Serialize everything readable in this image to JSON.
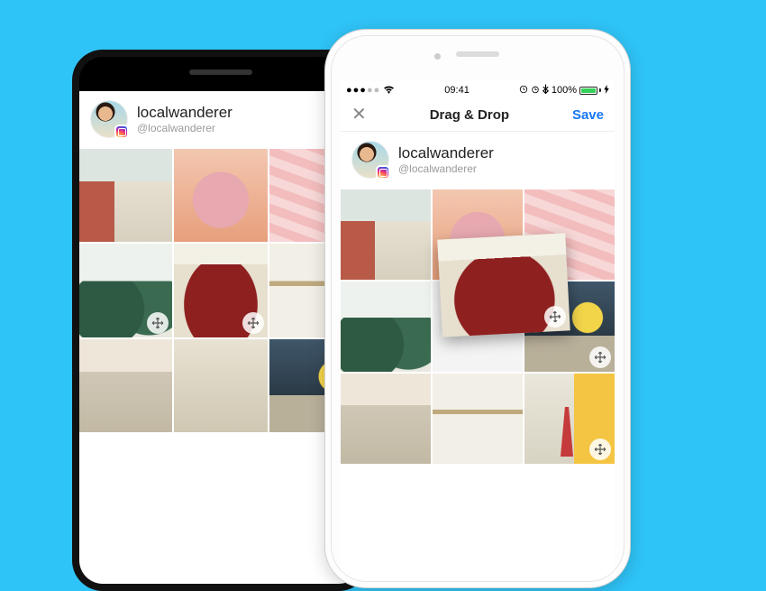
{
  "status": {
    "time": "09:41",
    "battery_pct": "100%"
  },
  "nav": {
    "title": "Drag & Drop",
    "save": "Save"
  },
  "profile": {
    "display_name": "localwanderer",
    "handle": "@localwanderer"
  }
}
